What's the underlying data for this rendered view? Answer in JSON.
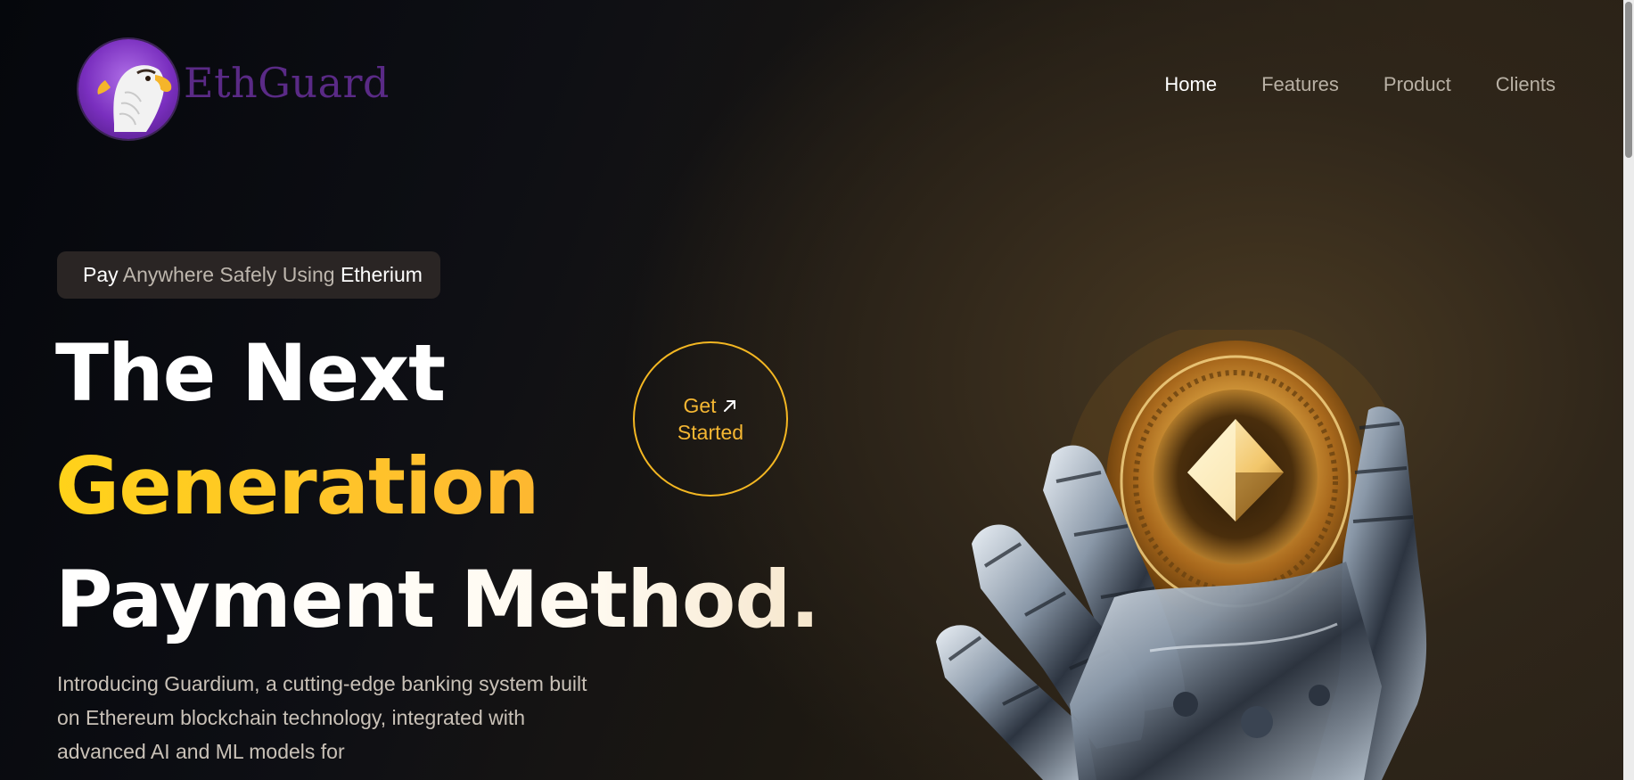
{
  "brand": {
    "name": "EthGuard",
    "logo_icon": "eagle-icon"
  },
  "nav": {
    "items": [
      {
        "label": "Home",
        "active": true
      },
      {
        "label": "Features",
        "active": false
      },
      {
        "label": "Product",
        "active": false
      },
      {
        "label": "Clients",
        "active": false
      }
    ]
  },
  "hero": {
    "badge": {
      "part1": "Pay",
      "part2": " Anywhere Safely Using ",
      "part3": "Etherium"
    },
    "headline": {
      "line1": "The Next",
      "line2": "Generation",
      "line3": "Payment Method."
    },
    "cta": {
      "line1": "Get",
      "line2": "Started",
      "icon": "arrow-up-right-icon"
    },
    "intro": "Introducing Guardium, a cutting-edge banking system built on Ethereum blockchain technology, integrated with advanced AI and ML models for",
    "image": "robot-hand-holding-ethereum-coin"
  },
  "colors": {
    "accent": "#f4b722",
    "brand_purple": "#5a2a86"
  }
}
